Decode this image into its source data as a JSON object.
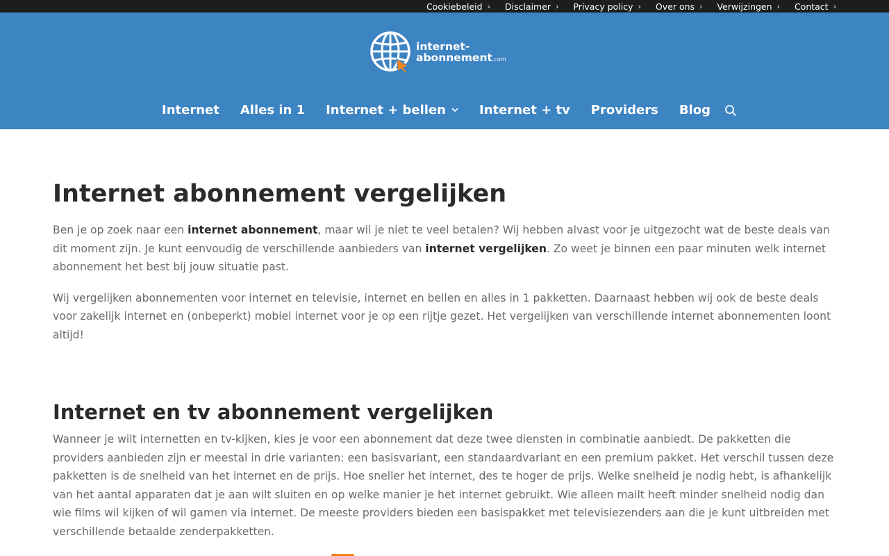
{
  "topbar": {
    "links": [
      {
        "label": "Cookiebeleid"
      },
      {
        "label": "Disclaimer"
      },
      {
        "label": "Privacy policy"
      },
      {
        "label": "Over ons"
      },
      {
        "label": "Verwijzingen"
      },
      {
        "label": "Contact"
      }
    ],
    "chevron": "›"
  },
  "logo": {
    "line1": "internet-",
    "line2": "abonnement",
    "tld": ".com",
    "icon": "globe-cursor-icon"
  },
  "nav": {
    "items": [
      {
        "label": "Internet"
      },
      {
        "label": "Alles in 1"
      },
      {
        "label": "Internet + bellen",
        "has_dropdown": true
      },
      {
        "label": "Internet + tv"
      },
      {
        "label": "Providers"
      },
      {
        "label": "Blog"
      }
    ],
    "search_icon": "search-icon"
  },
  "content": {
    "title": "Internet abonnement vergelijken",
    "intro": {
      "part1": "Ben je op zoek naar een ",
      "bold1": "internet abonnement",
      "part2": ", maar wil je niet te veel betalen? Wij hebben alvast voor je uitgezocht wat de beste deals van dit moment zijn. Je kunt eenvoudig de verschillende aanbieders van ",
      "bold2": "internet vergelijken",
      "part3": ". Zo weet je binnen een paar minuten welk internet abonnement het best bij jouw situatie past."
    },
    "paragraph2": "Wij vergelijken abonnementen voor internet en televisie, internet en bellen en alles in 1 pakketten. Daarnaast hebben wij ook de beste deals voor zakelijk internet en (onbeperkt) mobiel internet voor je op een rijtje gezet. Het vergelijken van verschillende internet abonnementen loont altijd!",
    "section2": {
      "heading": "Internet en tv abonnement vergelijken",
      "paragraph": "Wanneer je wilt internetten en tv-kijken, kies je voor een abonnement dat deze twee diensten in combinatie aanbiedt. De pakketten die providers aanbieden zijn er meestal in drie varianten: een basisvariant, een standaardvariant en een premium pakket. Het verschil tussen deze pakketten is de snelheid van het internet en de prijs. Hoe sneller het internet, des te hoger de prijs. Welke snelheid je nodig hebt, is afhankelijk van het aantal apparaten dat je aan wilt sluiten en op welke manier je het internet gebruikt. Wie alleen mailt heeft minder snelheid nodig dan wie films wil kijken of wil gamen via internet. De meeste providers bieden een basispakket met televisiezenders aan die je kunt uitbreiden met verschillende betaalde zenderpakketten."
    }
  },
  "colors": {
    "header_bg": "#3d84c3",
    "topbar_bg": "#1d1d1d",
    "accent_orange": "#f28322",
    "heading_text": "#2b2b2b",
    "body_text": "#6b6b6b"
  }
}
